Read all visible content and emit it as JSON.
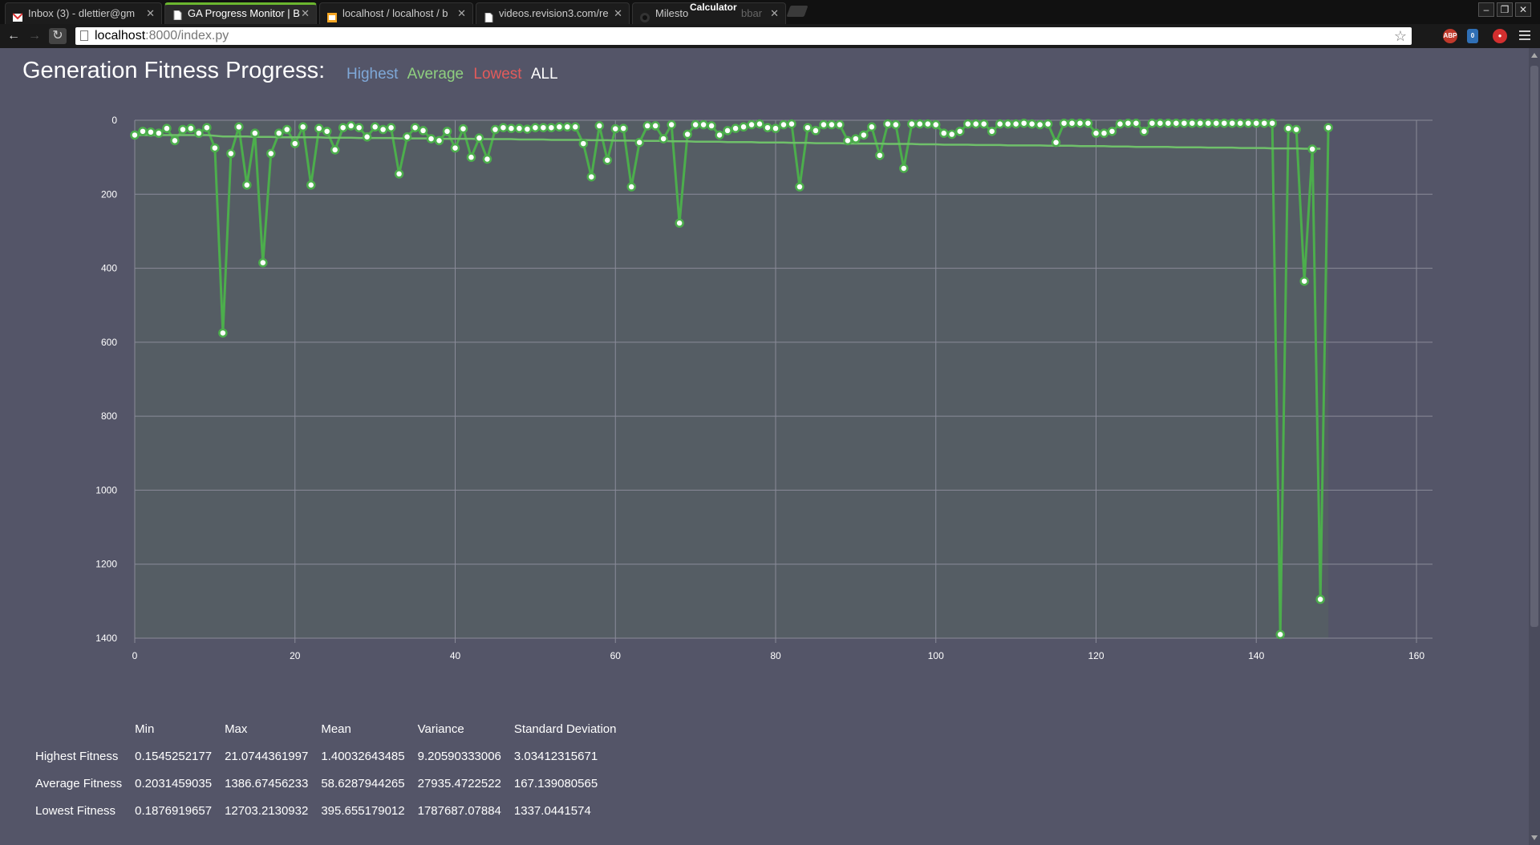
{
  "browser": {
    "tabs": [
      {
        "title": "Inbox (3) - dlettier@gm",
        "icon": "gmail-icon",
        "active": false
      },
      {
        "title": "GA Progress Monitor | B",
        "icon": "page-icon",
        "active": true
      },
      {
        "title": "localhost / localhost / b",
        "icon": "phpmyadmin-icon",
        "active": false
      },
      {
        "title": "videos.revision3.com/re",
        "icon": "page-icon",
        "active": false
      },
      {
        "title": "Milesto",
        "icon": "github-icon",
        "active": false
      }
    ],
    "overlay_tab_text": "bbar",
    "calculator_label": "Calculator",
    "url_host": "localhost",
    "url_rest": ":8000/index.py",
    "extensions": [
      "ABP",
      "0"
    ]
  },
  "page": {
    "title": "Generation Fitness Progress:",
    "links": {
      "highest": "Highest",
      "average": "Average",
      "lowest": "Lowest",
      "all": "ALL"
    }
  },
  "colors": {
    "background": "#545568",
    "plot_area": "#555d64",
    "series": "#4cae4c",
    "highest_link": "#7fa8d8",
    "average_link": "#8fcf7f",
    "lowest_link": "#e25b5b"
  },
  "chart_data": {
    "type": "line",
    "title": "",
    "xlabel": "",
    "ylabel": "",
    "xlim": [
      0,
      160
    ],
    "ylim": [
      0,
      1400
    ],
    "y_inverted": true,
    "grid": true,
    "x_ticks": [
      0,
      20,
      40,
      60,
      80,
      100,
      120,
      140,
      160
    ],
    "y_ticks": [
      0,
      200,
      400,
      600,
      800,
      1000,
      1200,
      1400
    ],
    "series": [
      {
        "markers": true,
        "values": [
          40,
          30,
          32,
          35,
          22,
          55,
          25,
          22,
          35,
          20,
          75,
          575,
          90,
          18,
          175,
          35,
          385,
          90,
          35,
          25,
          63,
          18,
          175,
          22,
          30,
          80,
          20,
          15,
          20,
          45,
          18,
          25,
          20,
          145,
          45,
          20,
          28,
          50,
          55,
          30,
          75,
          23,
          100,
          48,
          105,
          25,
          20,
          22,
          22,
          24,
          20,
          20,
          20,
          18,
          18,
          18,
          63,
          153,
          15,
          108,
          23,
          22,
          180,
          60,
          15,
          15,
          50,
          12,
          278,
          38,
          12,
          12,
          15,
          40,
          28,
          22,
          18,
          12,
          10,
          20,
          22,
          12,
          10,
          180,
          20,
          28,
          12,
          12,
          12,
          55,
          50,
          40,
          18,
          95,
          10,
          12,
          130,
          10,
          10,
          10,
          12,
          35,
          38,
          30,
          10,
          10,
          10,
          30,
          10,
          10,
          10,
          8,
          10,
          12,
          10,
          60,
          8,
          8,
          8,
          8,
          35,
          35,
          30,
          10,
          8,
          8,
          30,
          8,
          8,
          8,
          8,
          8,
          8,
          8,
          8,
          8,
          8,
          8,
          8,
          8,
          8,
          8,
          8,
          1390,
          22,
          25,
          435,
          78,
          1295,
          20
        ]
      },
      {
        "markers": false,
        "values": [
          40,
          40,
          40,
          40,
          40,
          40,
          40,
          40,
          40,
          40,
          42,
          44,
          44,
          44,
          44,
          45,
          45,
          45,
          46,
          46,
          46,
          46,
          46,
          46,
          47,
          47,
          47,
          47,
          48,
          48,
          48,
          48,
          48,
          49,
          49,
          49,
          49,
          49,
          50,
          50,
          50,
          50,
          50,
          51,
          51,
          51,
          51,
          51,
          52,
          52,
          52,
          52,
          53,
          53,
          53,
          53,
          53,
          54,
          54,
          54,
          55,
          55,
          55,
          56,
          56,
          56,
          56,
          57,
          57,
          57,
          58,
          58,
          58,
          58,
          59,
          59,
          59,
          59,
          60,
          60,
          60,
          60,
          61,
          61,
          61,
          62,
          62,
          62,
          62,
          63,
          63,
          63,
          63,
          63,
          64,
          64,
          64,
          64,
          65,
          65,
          65,
          66,
          66,
          66,
          66,
          67,
          67,
          67,
          67,
          68,
          68,
          68,
          68,
          68,
          69,
          69,
          69,
          69,
          70,
          70,
          70,
          70,
          71,
          71,
          71,
          72,
          72,
          72,
          72,
          72,
          73,
          73,
          73,
          73,
          74,
          74,
          74,
          74,
          75,
          75,
          75,
          75,
          76,
          76,
          76,
          76,
          77,
          77,
          77
        ]
      }
    ]
  },
  "stats": {
    "headers": [
      "Min",
      "Max",
      "Mean",
      "Variance",
      "Standard Deviation"
    ],
    "rows": [
      {
        "label": "Highest Fitness",
        "values": [
          "0.1545252177",
          "21.0744361997",
          "1.40032643485",
          "9.20590333006",
          "3.03412315671"
        ]
      },
      {
        "label": "Average Fitness",
        "values": [
          "0.2031459035",
          "1386.67456233",
          "58.6287944265",
          "27935.4722522",
          "167.139080565"
        ]
      },
      {
        "label": "Lowest Fitness",
        "values": [
          "0.1876919657",
          "12703.2130932",
          "395.655179012",
          "1787687.07884",
          "1337.0441574"
        ]
      }
    ]
  }
}
